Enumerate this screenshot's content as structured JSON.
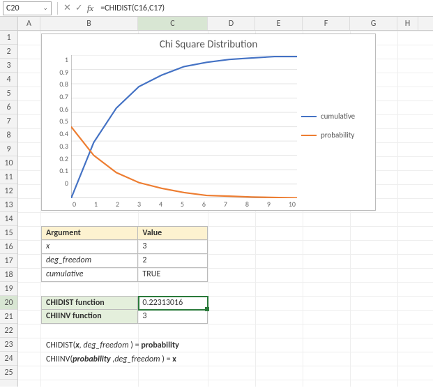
{
  "nameBox": "C20",
  "formula": "=CHIDIST(C16,C17)",
  "columns": [
    "A",
    "B",
    "C",
    "D",
    "E",
    "F",
    "G",
    "H"
  ],
  "selectedCol": "C",
  "rows": [
    "1",
    "2",
    "3",
    "4",
    "5",
    "6",
    "7",
    "8",
    "9",
    "10",
    "11",
    "12",
    "13",
    "14",
    "15",
    "16",
    "17",
    "18",
    "19",
    "20",
    "21",
    "22",
    "23",
    "24",
    "25"
  ],
  "selectedRow": "20",
  "chart_data": {
    "type": "line",
    "title": "Chi Square Distribution",
    "xlabel": "",
    "ylabel": "",
    "xlim": [
      0,
      10
    ],
    "ylim": [
      0,
      1
    ],
    "x_ticks": [
      "0",
      "1",
      "2",
      "3",
      "4",
      "5",
      "6",
      "7",
      "8",
      "9",
      "10"
    ],
    "y_ticks": [
      "0",
      "0.1",
      "0.2",
      "0.3",
      "0.4",
      "0.5",
      "0.6",
      "0.7",
      "0.8",
      "0.9",
      "1"
    ],
    "x": [
      0,
      1,
      2,
      3,
      4,
      5,
      6,
      7,
      8,
      9,
      10
    ],
    "series": [
      {
        "name": "cumulative",
        "color": "#4472c4",
        "values": [
          0.0,
          0.39,
          0.63,
          0.78,
          0.86,
          0.92,
          0.95,
          0.97,
          0.98,
          0.99,
          0.99
        ]
      },
      {
        "name": "probability",
        "color": "#ed7d31",
        "values": [
          0.5,
          0.3,
          0.18,
          0.11,
          0.07,
          0.04,
          0.02,
          0.015,
          0.009,
          0.006,
          0.003
        ]
      }
    ],
    "legend_position": "right"
  },
  "argTable": {
    "headers": [
      "Argument",
      "Value"
    ],
    "rows": [
      {
        "arg": "x",
        "val": "3"
      },
      {
        "arg": "deg_freedom",
        "val": "2"
      },
      {
        "arg": "cumulative",
        "val": "TRUE"
      }
    ]
  },
  "funcTable": {
    "rows": [
      {
        "label": "CHIDIST function",
        "val": "0.22313016"
      },
      {
        "label": "CHIINV function",
        "val": "3"
      }
    ]
  },
  "notes": {
    "line1": {
      "fn": "CHIDIST",
      "a1": "x",
      "a2": "deg_freedom",
      "eq": "probability"
    },
    "line2": {
      "fn": "CHIINV",
      "a1": "probability",
      "a2": "deg_freedom",
      "eq": "x"
    }
  },
  "icons": {
    "cancel": "✕",
    "confirm": "✓",
    "fx": "fx",
    "chev": "⌄"
  }
}
